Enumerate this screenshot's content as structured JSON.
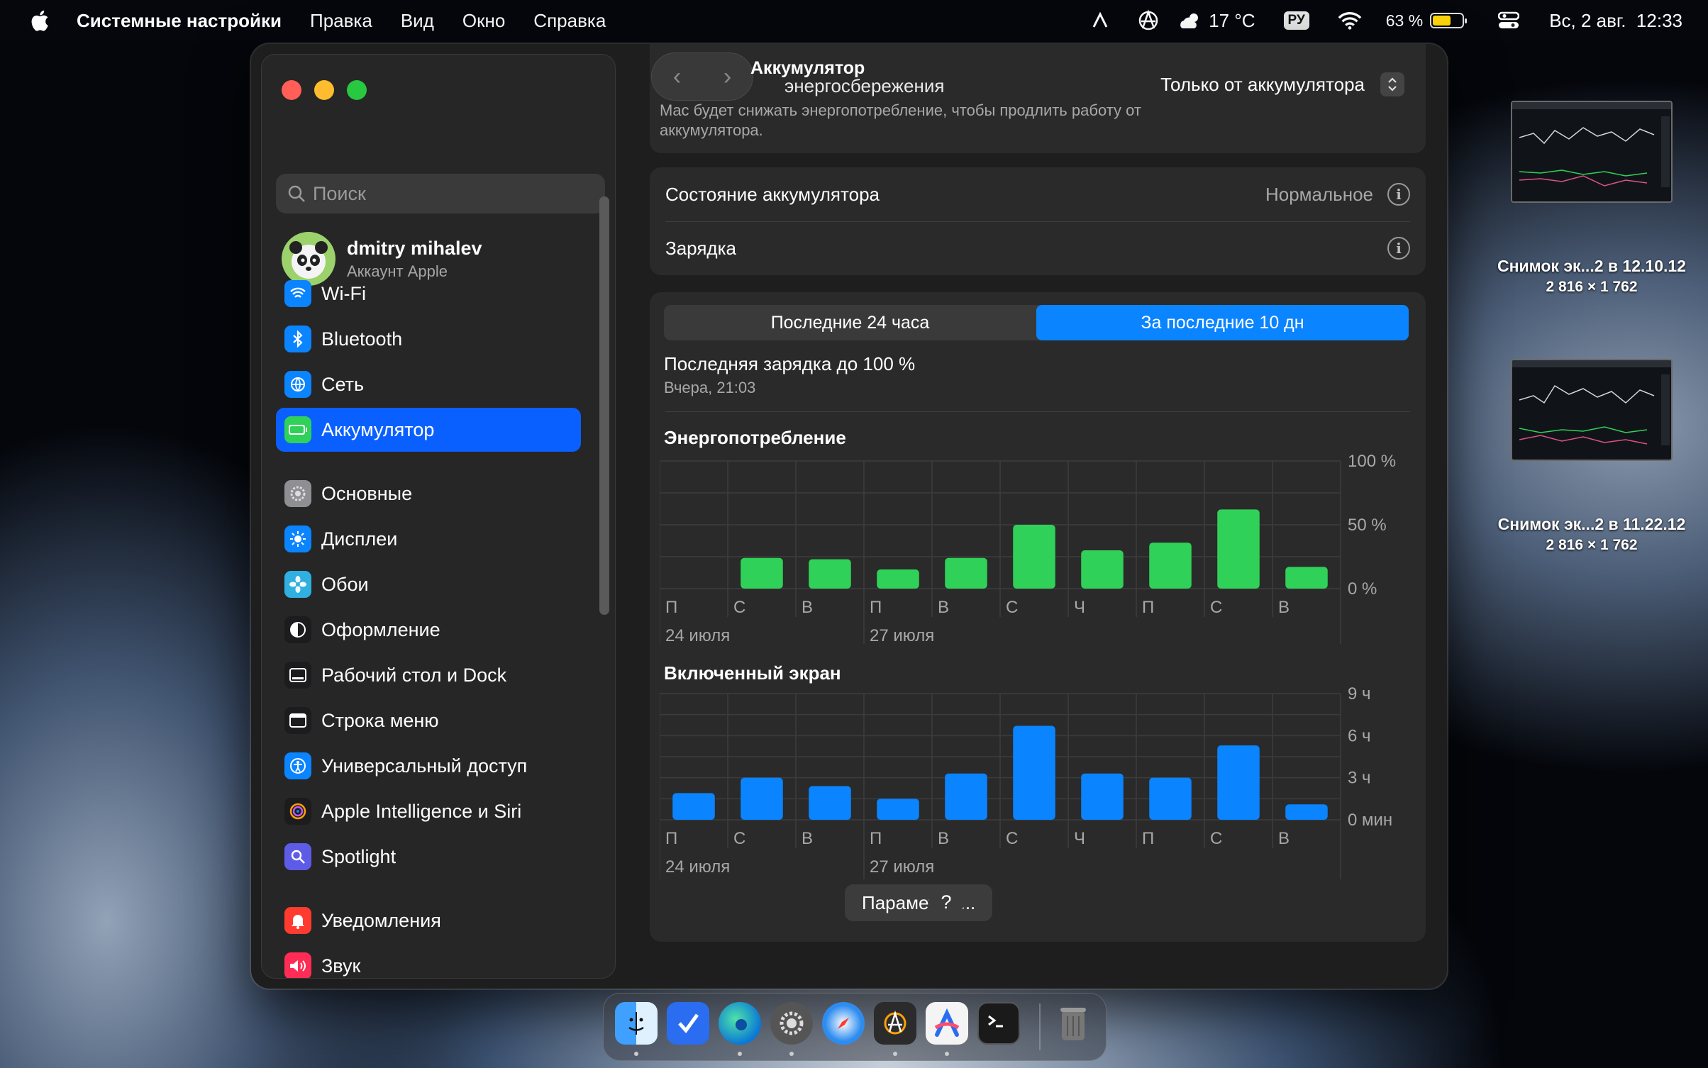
{
  "menubar": {
    "app_name": "Системные настройки",
    "items": [
      "Правка",
      "Вид",
      "Окно",
      "Справка"
    ],
    "weather": "17 °C",
    "keyboard": "РУ",
    "battery_percent": "63 %",
    "battery_level": 0.63,
    "datetime": "Вс, 2 авг.  12:33"
  },
  "sidebar": {
    "search_placeholder": "Поиск",
    "account": {
      "name": "dmitry mihalev",
      "subtitle": "Аккаунт Apple"
    },
    "items": [
      {
        "label": "Wi-Fi",
        "icon": "wifi-icon",
        "color": "#0a84ff"
      },
      {
        "label": "Bluetooth",
        "icon": "bluetooth-icon",
        "color": "#0a84ff"
      },
      {
        "label": "Сеть",
        "icon": "globe-icon",
        "color": "#0a84ff"
      },
      {
        "label": "Аккумулятор",
        "icon": "battery-icon",
        "color": "#30d158",
        "active": true
      },
      {
        "label": "Основные",
        "icon": "gear-icon",
        "color": "#8e8e93"
      },
      {
        "label": "Дисплеи",
        "icon": "sun-icon",
        "color": "#0a84ff"
      },
      {
        "label": "Обои",
        "icon": "flower-icon",
        "color": "#30b0e0"
      },
      {
        "label": "Оформление",
        "icon": "appearance-icon",
        "color": "#1c1c1e"
      },
      {
        "label": "Рабочий стол и Dock",
        "icon": "dock-icon",
        "color": "#1c1c1e"
      },
      {
        "label": "Строка меню",
        "icon": "menubar-icon",
        "color": "#1c1c1e"
      },
      {
        "label": "Универсальный доступ",
        "icon": "accessibility-icon",
        "color": "#0a84ff"
      },
      {
        "label": "Apple Intelligence и Siri",
        "icon": "siri-icon",
        "color": "#1c1c1e"
      },
      {
        "label": "Spotlight",
        "icon": "spotlight-icon",
        "color": "#5e5ce6"
      },
      {
        "label": "Уведомления",
        "icon": "bell-icon",
        "color": "#ff3b30"
      },
      {
        "label": "Звук",
        "icon": "speaker-icon",
        "color": "#ff2d55"
      }
    ]
  },
  "main": {
    "title": "Аккумулятор",
    "mode_label": "энергосбережения",
    "mode_desc": "Mac будет снижать энергопотребление, чтобы продлить работу от аккумулятора.",
    "mode_value": "Только от аккумулятора",
    "health_label": "Состояние аккумулятора",
    "health_value": "Нормальное",
    "charging_label": "Зарядка",
    "tabs": [
      "Последние 24 часа",
      "За последние 10 дн"
    ],
    "active_tab": 1,
    "last_charge": "Последняя зарядка до 100 %",
    "last_charge_time": "Вчера, 21:03",
    "params_button": "Параметры...",
    "help_button": "?"
  },
  "chart_data": [
    {
      "type": "bar",
      "title": "Энергопотребление",
      "categories": [
        "П",
        "С",
        "В",
        "П",
        "В",
        "С",
        "Ч",
        "П",
        "С",
        "В"
      ],
      "date_labels": [
        {
          "index": 0,
          "label": "24 июля"
        },
        {
          "index": 3,
          "label": "27 июля"
        }
      ],
      "values": [
        0,
        24,
        23,
        15,
        24,
        50,
        30,
        36,
        62,
        17
      ],
      "ylim": [
        0,
        100
      ],
      "y_ticks": [
        "100 %",
        "50 %",
        "0 %"
      ],
      "color": "#30d158"
    },
    {
      "type": "bar",
      "title": "Включенный экран",
      "categories": [
        "П",
        "С",
        "В",
        "П",
        "В",
        "С",
        "Ч",
        "П",
        "С",
        "В"
      ],
      "date_labels": [
        {
          "index": 0,
          "label": "24 июля"
        },
        {
          "index": 3,
          "label": "27 июля"
        }
      ],
      "values": [
        1.9,
        3.0,
        2.4,
        1.5,
        3.3,
        6.7,
        3.3,
        3.0,
        5.3,
        1.1
      ],
      "ylim": [
        0,
        9
      ],
      "y_ticks": [
        "9 ч",
        "6 ч",
        "3 ч",
        "0 мин"
      ],
      "color": "#0a84ff"
    }
  ],
  "desktop": {
    "files": [
      {
        "name": "Снимок эк...2 в 12.10.12",
        "dims": "2 816 × 1 762"
      },
      {
        "name": "Снимок эк...2 в 11.22.12",
        "dims": "2 816 × 1 762"
      }
    ]
  },
  "dock": {
    "apps": [
      "finder-icon",
      "tasks-icon",
      "edge-icon",
      "settings-icon",
      "safari-icon",
      "compass-app-icon",
      "arc-icon",
      "terminal-icon",
      "trash-icon"
    ]
  }
}
